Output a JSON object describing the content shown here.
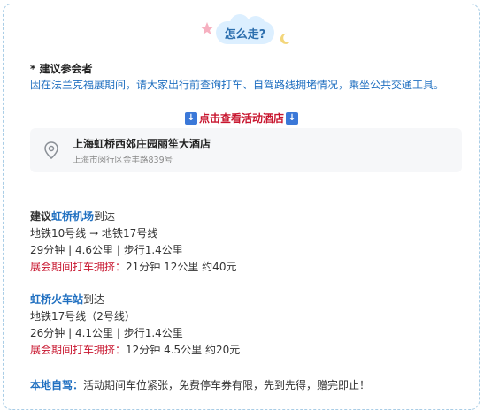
{
  "header": {
    "title": "怎么走?"
  },
  "note": {
    "heading": "* 建议参会者",
    "body": "因在法兰克福展期间，请大家出行前查询打车、自驾路线拥堵情况，乘坐公共交通工具。"
  },
  "hotel_link": {
    "icon_text": "↓",
    "label": "点击查看活动酒店"
  },
  "address": {
    "name": "上海虹桥西郊庄园丽笙大酒店",
    "detail": "上海市闵行区金丰路839号"
  },
  "routes": {
    "airport": {
      "prefix": "建议",
      "station": "虹桥机场",
      "suffix": "到达",
      "metro": "地铁10号线 → 地铁17号线",
      "stats": "29分钟 | 4.6公里 | 步行1.4公里",
      "taxi_label": "展会期间打车拥挤：",
      "taxi_info": "21分钟 12公里 约40元"
    },
    "train": {
      "station": "虹桥火车站",
      "suffix": "到达",
      "metro": "地铁17号线（2号线）",
      "stats": "26分钟 | 4.1公里 | 步行1.4公里",
      "taxi_label": "展会期间打车拥挤：",
      "taxi_info": "12分钟 4.5公里 约20元"
    },
    "drive": {
      "label": "本地自驾：",
      "info": "活动期间车位紧张，免费停车券有限，先到先得，赠完即止！"
    }
  },
  "colors": {
    "accent_blue": "#1f6fc0",
    "accent_red": "#c8162f",
    "border": "#a9cde6"
  }
}
